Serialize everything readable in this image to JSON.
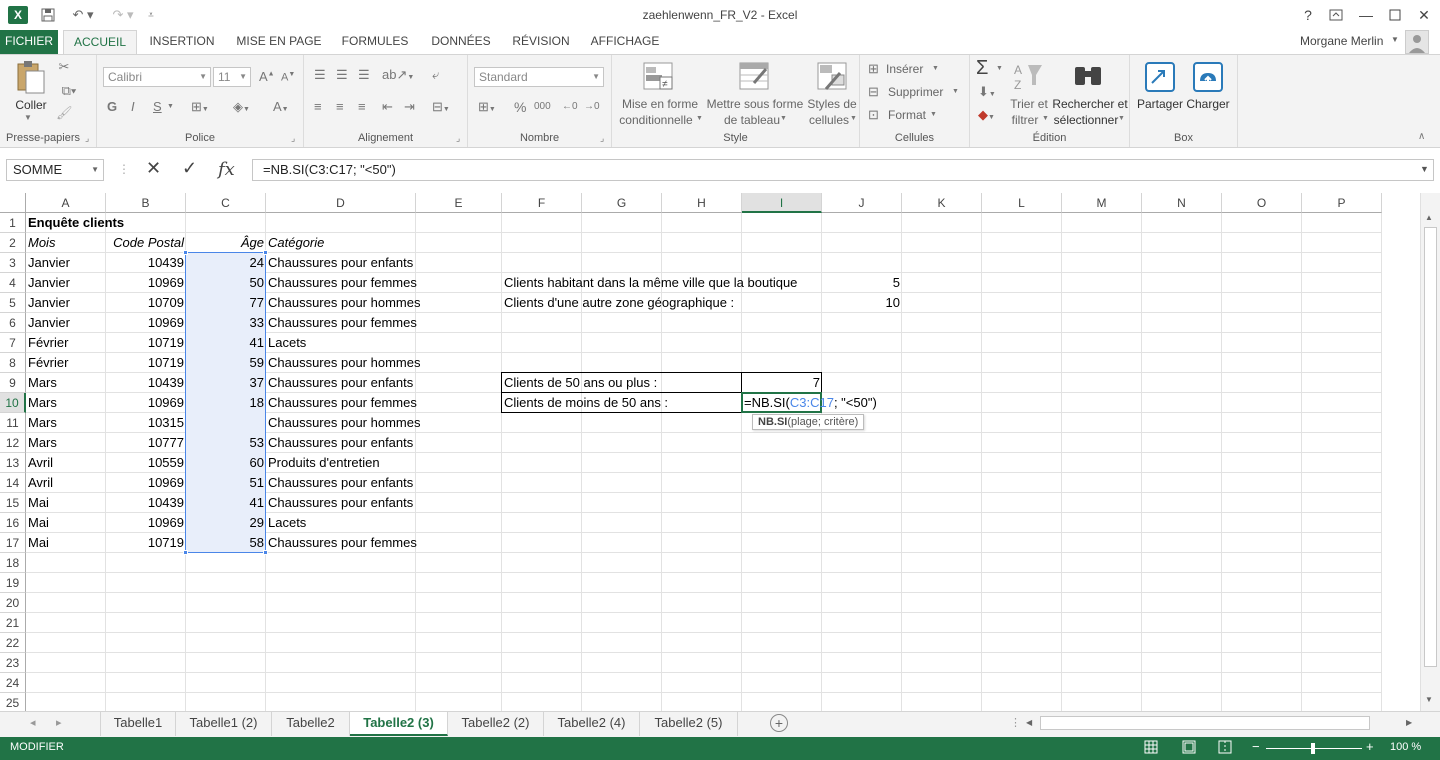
{
  "window": {
    "title": "zaehlenwenn_FR_V2 - Excel",
    "user": "Morgane Merlin"
  },
  "ribbon_tabs": [
    {
      "label": "FICHIER"
    },
    {
      "label": "ACCUEIL"
    },
    {
      "label": "INSERTION"
    },
    {
      "label": "MISE EN PAGE"
    },
    {
      "label": "FORMULES"
    },
    {
      "label": "DONNÉES"
    },
    {
      "label": "RÉVISION"
    },
    {
      "label": "AFFICHAGE"
    }
  ],
  "ribbon": {
    "clipboard": {
      "paste_label": "Coller",
      "group_label": "Presse-papiers"
    },
    "font": {
      "font_name": "Calibri",
      "font_size": "11",
      "bold": "G",
      "italic": "I",
      "underline": "S",
      "group_label": "Police"
    },
    "alignment": {
      "group_label": "Alignement"
    },
    "number": {
      "format": "Standard",
      "percent": "%",
      "thousands": "000",
      "group_label": "Nombre"
    },
    "style": {
      "conditional_l1": "Mise en forme",
      "conditional_l2": "conditionnelle",
      "table_l1": "Mettre sous forme",
      "table_l2": "de tableau",
      "cellstyles_l1": "Styles de",
      "cellstyles_l2": "cellules",
      "group_label": "Style"
    },
    "cells": {
      "insert": "Insérer",
      "delete": "Supprimer",
      "format": "Format",
      "group_label": "Cellules"
    },
    "editing": {
      "sort_l1": "Trier et",
      "sort_l2": "filtrer",
      "find_l1": "Rechercher et",
      "find_l2": "sélectionner",
      "group_label": "Édition"
    },
    "box": {
      "share": "Partager",
      "upload": "Charger",
      "group_label": "Box"
    }
  },
  "formula_bar": {
    "name_box": "SOMME",
    "fx": "fx",
    "formula": "=NB.SI(C3:C17; \"<50\")"
  },
  "columns": [
    "A",
    "B",
    "C",
    "D",
    "E",
    "F",
    "G",
    "H",
    "I",
    "J",
    "K",
    "L",
    "M",
    "N",
    "O",
    "P"
  ],
  "rows": [
    "1",
    "2",
    "3",
    "4",
    "5",
    "6",
    "7",
    "8",
    "9",
    "10",
    "11",
    "12",
    "13",
    "14",
    "15",
    "16",
    "17",
    "18",
    "19",
    "20",
    "21",
    "22",
    "23",
    "24",
    "25"
  ],
  "cells": {
    "A1": "Enquête clients",
    "A2": "Mois",
    "B2": "Code Postal",
    "C2": "Âge",
    "D2": "Catégorie",
    "A3": "Janvier",
    "B3": "10439",
    "C3": "24",
    "D3": "Chaussures pour enfants",
    "A4": "Janvier",
    "B4": "10969",
    "C4": "50",
    "D4": "Chaussures pour femmes",
    "A5": "Janvier",
    "B5": "10709",
    "C5": "77",
    "D5": "Chaussures pour hommes",
    "A6": "Janvier",
    "B6": "10969",
    "C6": "33",
    "D6": "Chaussures pour femmes",
    "A7": "Février",
    "B7": "10719",
    "C7": "41",
    "D7": "Lacets",
    "A8": "Février",
    "B8": "10719",
    "C8": "59",
    "D8": "Chaussures pour hommes",
    "A9": "Mars",
    "B9": "10439",
    "C9": "37",
    "D9": "Chaussures pour enfants",
    "A10": "Mars",
    "B10": "10969",
    "C10": "18",
    "D10": "Chaussures pour femmes",
    "A11": "Mars",
    "B11": "10315",
    "C11": "",
    "D11": "Chaussures pour hommes",
    "A12": "Mars",
    "B12": "10777",
    "C12": "53",
    "D12": "Chaussures pour enfants",
    "A13": "Avril",
    "B13": "10559",
    "C13": "60",
    "D13": "Produits d'entretien",
    "A14": "Avril",
    "B14": "10969",
    "C14": "51",
    "D14": "Chaussures pour enfants",
    "A15": "Mai",
    "B15": "10439",
    "C15": "41",
    "D15": "Chaussures pour enfants",
    "A16": "Mai",
    "B16": "10969",
    "C16": "29",
    "D16": "Lacets",
    "A17": "Mai",
    "B17": "10719",
    "C17": "58",
    "D17": "Chaussures pour femmes",
    "F4": "Clients habitant dans la même ville que la boutique",
    "J4": "5",
    "F5": "Clients d'une autre zone géographique :",
    "J5": "10",
    "F9": "Clients de 50 ans ou plus :",
    "I9": "7",
    "F10": "Clients de moins de 50 ans :",
    "I10_a": "=NB.SI(",
    "I10_b": "C3:C17",
    "I10_c": "; \"<50\")"
  },
  "tooltip": {
    "fn": "NB.SI",
    "args": "(plage; critère)"
  },
  "sheet_tabs": [
    {
      "label": "Tabelle1"
    },
    {
      "label": "Tabelle1 (2)"
    },
    {
      "label": "Tabelle2"
    },
    {
      "label": "Tabelle2 (3)"
    },
    {
      "label": "Tabelle2 (2)"
    },
    {
      "label": "Tabelle2 (4)"
    },
    {
      "label": "Tabelle2 (5)"
    }
  ],
  "status": {
    "mode": "MODIFIER",
    "zoom": "100 %"
  },
  "colors": {
    "accent": "#217346",
    "range_highlight": "#4a86e8"
  }
}
